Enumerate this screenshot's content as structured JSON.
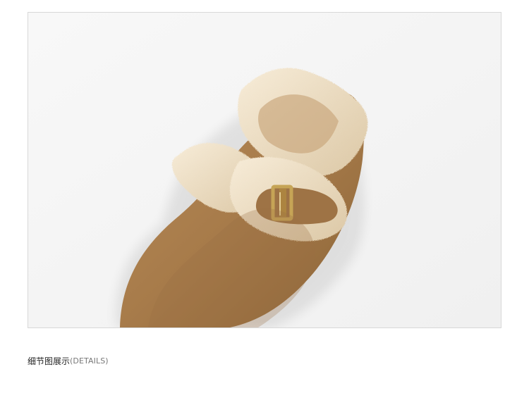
{
  "product_photo": {
    "subject": "shoe-photo",
    "colors": {
      "background": "#f5f5f5",
      "suede": "#a77b4a",
      "suede_shadow": "#7e5b36",
      "fleece": "#efe2c8",
      "fleece_shadow": "#d8c6a1",
      "buckle": "#c6a456"
    }
  },
  "section": {
    "title_zh": "细节图展示",
    "title_en": "(DETAILS)"
  }
}
